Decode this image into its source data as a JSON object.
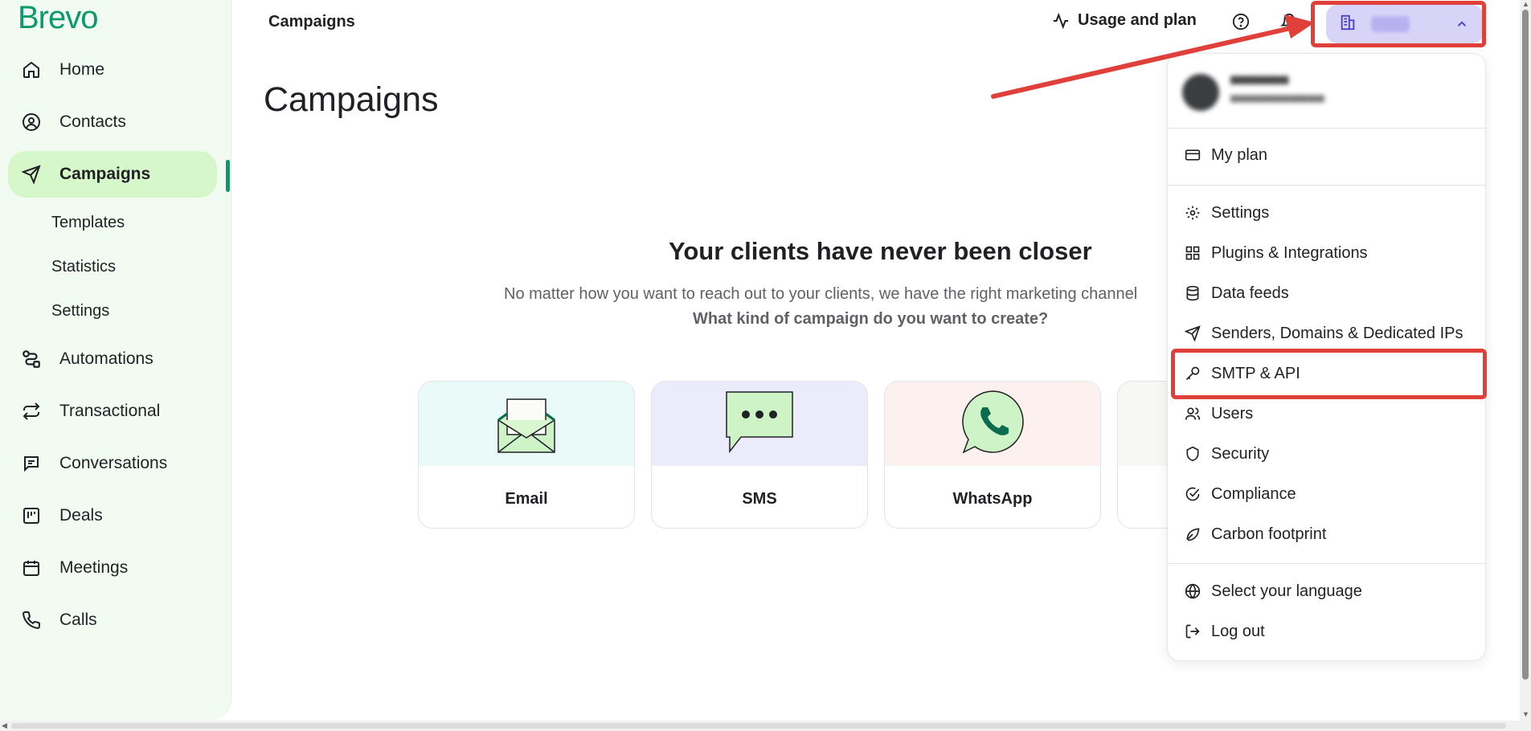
{
  "brand": {
    "logo": "Brevo",
    "accent": "#0b996e"
  },
  "sidebar": {
    "items": [
      {
        "label": "Home",
        "icon": "home-icon"
      },
      {
        "label": "Contacts",
        "icon": "contacts-icon"
      },
      {
        "label": "Campaigns",
        "icon": "send-icon",
        "active": true
      },
      {
        "label": "Automations",
        "icon": "automations-icon"
      },
      {
        "label": "Transactional",
        "icon": "transactional-icon"
      },
      {
        "label": "Conversations",
        "icon": "conversations-icon"
      },
      {
        "label": "Deals",
        "icon": "deals-icon"
      },
      {
        "label": "Meetings",
        "icon": "calendar-icon"
      },
      {
        "label": "Calls",
        "icon": "phone-icon"
      }
    ],
    "sub_items": [
      "Templates",
      "Statistics",
      "Settings"
    ]
  },
  "topbar": {
    "title": "Campaigns",
    "usage_label": "Usage and plan"
  },
  "main": {
    "page_title": "Campaigns",
    "hero_title": "Your clients have never been closer",
    "hero_subtitle": "No matter how you want to reach out to your clients, we have the right marketing channel",
    "hero_question": "What kind of campaign do you want to create?",
    "cards": [
      {
        "label": "Email",
        "bg": "#eafaf9",
        "icon": "envelope-icon"
      },
      {
        "label": "SMS",
        "bg": "#ecebfb",
        "icon": "sms-bubble-icon"
      },
      {
        "label": "WhatsApp",
        "bg": "#fdf1ef",
        "icon": "whatsapp-icon"
      }
    ]
  },
  "dropdown": {
    "items": [
      {
        "label": "My plan",
        "icon": "card-icon"
      },
      {
        "label": "Settings",
        "icon": "gear-icon"
      },
      {
        "label": "Plugins & Integrations",
        "icon": "grid-icon"
      },
      {
        "label": "Data feeds",
        "icon": "database-icon"
      },
      {
        "label": "Senders, Domains & Dedicated IPs",
        "icon": "send-icon"
      },
      {
        "label": "SMTP & API",
        "icon": "key-icon"
      },
      {
        "label": "Users",
        "icon": "users-icon"
      },
      {
        "label": "Security",
        "icon": "shield-icon"
      },
      {
        "label": "Compliance",
        "icon": "check-circle-icon"
      },
      {
        "label": "Carbon footprint",
        "icon": "leaf-icon"
      },
      {
        "label": "Select your language",
        "icon": "globe-icon"
      },
      {
        "label": "Log out",
        "icon": "logout-icon"
      }
    ]
  },
  "annotation_color": "#e0403a"
}
